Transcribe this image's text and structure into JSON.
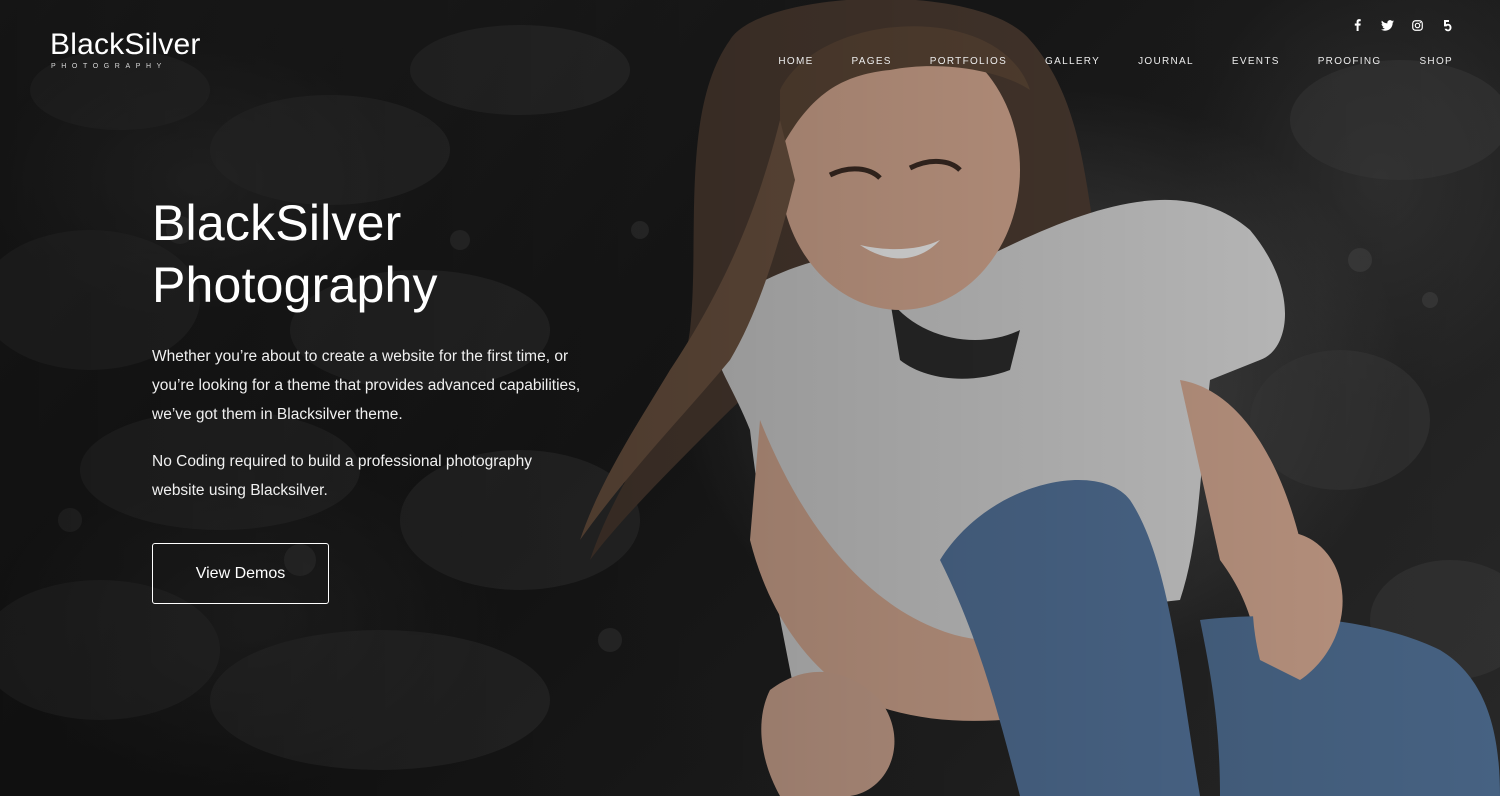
{
  "brand": {
    "name": "BlackSilver",
    "tagline": "PHOTOGRAPHY"
  },
  "social": [
    {
      "icon": "facebook-icon"
    },
    {
      "icon": "twitter-icon"
    },
    {
      "icon": "instagram-icon"
    },
    {
      "icon": "500px-icon"
    }
  ],
  "nav": {
    "items": [
      "HOME",
      "PAGES",
      "PORTFOLIOS",
      "GALLERY",
      "JOURNAL",
      "EVENTS",
      "PROOFING",
      "SHOP"
    ]
  },
  "hero": {
    "title_line1": "BlackSilver",
    "title_line2": "Photography",
    "paragraph1": "Whether you’re about to create a website for the first time, or you’re looking for a theme that provides advanced capabilities, we’ve got them in Blacksilver theme.",
    "paragraph2": "No Coding required to build a professional photography website using Blacksilver.",
    "cta_label": "View Demos"
  },
  "colors": {
    "text": "#ffffff",
    "background": "#1d1d1d"
  }
}
